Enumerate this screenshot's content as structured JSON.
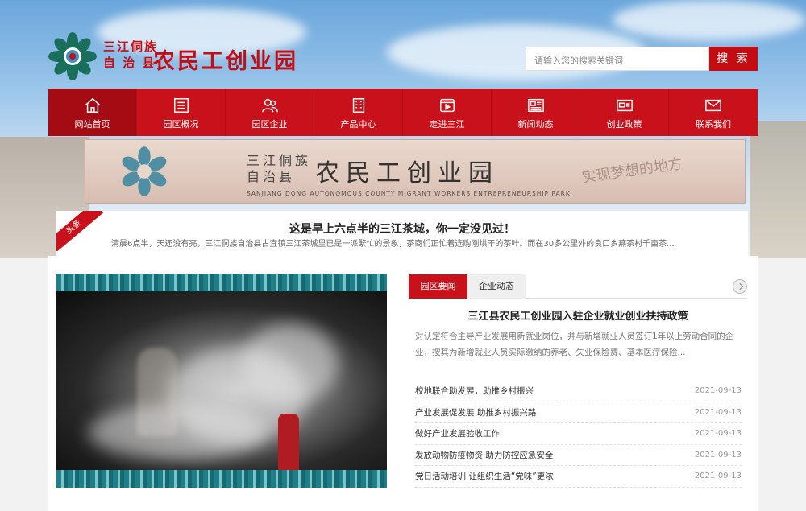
{
  "header": {
    "logo_small_line1": "三江侗族",
    "logo_small_line2": "自 治 县",
    "logo_big": "农民工创业园",
    "search_placeholder": "请输入您的搜索关键词",
    "search_button": "搜 索"
  },
  "nav": {
    "items": [
      {
        "label": "网站首页",
        "icon": "home-icon"
      },
      {
        "label": "园区概况",
        "icon": "list-icon"
      },
      {
        "label": "园区企业",
        "icon": "users-icon"
      },
      {
        "label": "产品中心",
        "icon": "building-icon"
      },
      {
        "label": "走进三江",
        "icon": "film-icon"
      },
      {
        "label": "新闻动态",
        "icon": "newspaper-icon"
      },
      {
        "label": "创业政策",
        "icon": "card-icon"
      },
      {
        "label": "联系我们",
        "icon": "mail-icon"
      }
    ]
  },
  "banner": {
    "small_line1": "三江侗族",
    "small_line2": "自治县",
    "big": "农民工创业园",
    "english": "SANJIANG DONG AUTONOMOUS COUNTY MIGRANT WORKERS ENTREPRENEURSHIP PARK",
    "script": "实现梦想的地方"
  },
  "headline": {
    "ribbon": "头条",
    "title": "这是早上六点半的三江茶城，你一定没见过！",
    "desc": "清晨6点半，天还没有亮，三江侗族自治县古宜镇三江茶城里已是一派繁忙的景象，茶商们正忙着选购刚烘干的茶叶。而在30多公里外的良口乡燕茶村千亩茶..."
  },
  "tabs": {
    "tab1": "园区要闻",
    "tab2": "企业动态"
  },
  "feature": {
    "title": "三江县农民工创业园入驻企业就业创业扶持政策",
    "desc": "对认定符合主导产业发展用新就业岗位，并与新增就业人员签订1年以上劳动合同的企业，按其为新增就业人员实际缴纳的养老、失业保险费、基本医疗保险..."
  },
  "news": [
    {
      "title": "校地联合助发展，助推乡村振兴",
      "date": "2021-09-13"
    },
    {
      "title": "产业发展促发展 助推乡村振兴路",
      "date": "2021-09-13"
    },
    {
      "title": "做好产业发展验收工作",
      "date": "2021-09-13"
    },
    {
      "title": "发放动物防疫物资 助力防控应急安全",
      "date": "2021-09-13"
    },
    {
      "title": "党日活动培训 让组织生活“党味”更浓",
      "date": "2021-09-13"
    }
  ],
  "colors": {
    "brand_red": "#c8111a",
    "nav_active": "#a50b12"
  }
}
